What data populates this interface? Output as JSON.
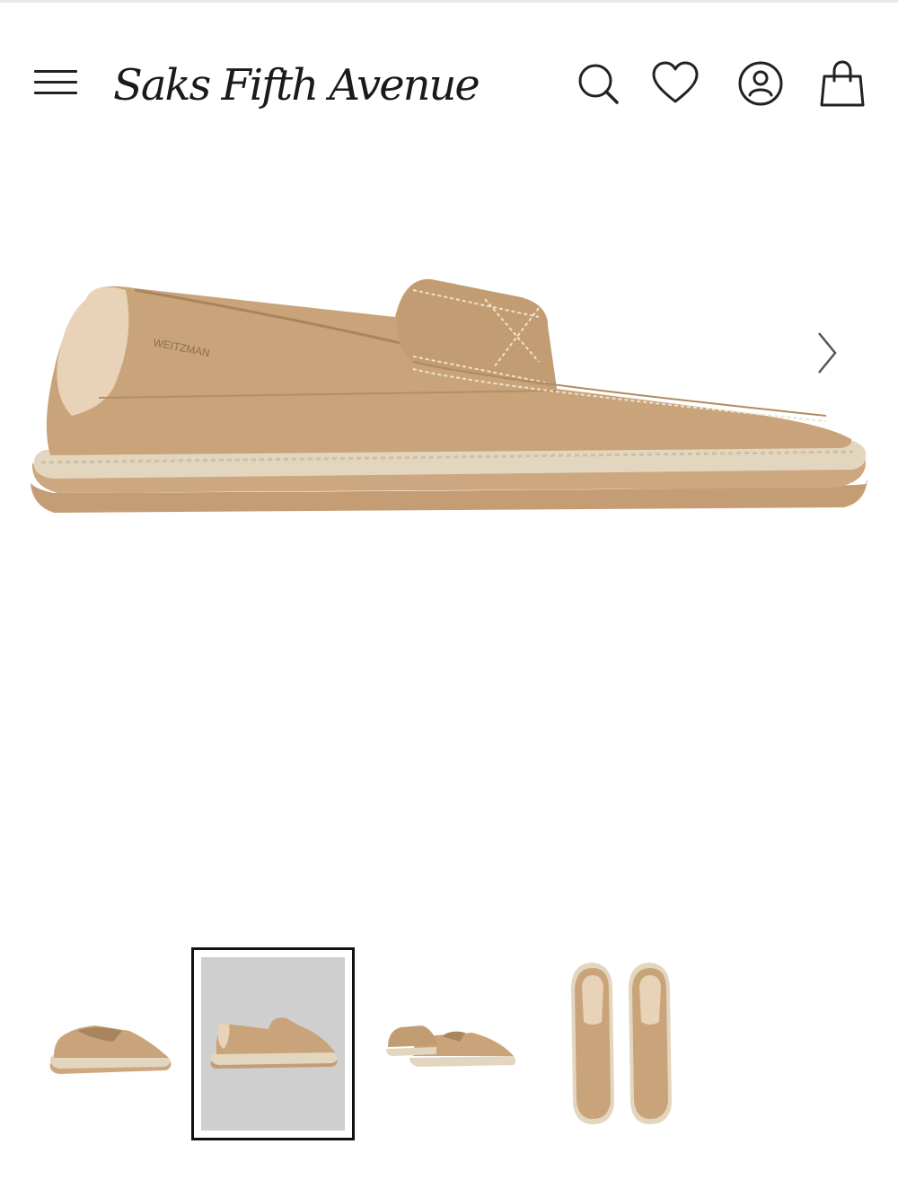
{
  "header": {
    "logo_text": "Saks Fifth Avenue",
    "icons": [
      "menu-icon",
      "search-icon",
      "heart-icon",
      "account-icon",
      "shopping-bag-icon"
    ]
  },
  "product": {
    "brand_mark": "WEITZMAN",
    "colors": {
      "suede": "#c9a47a",
      "rope": "#e3d6bf",
      "sole": "#caa47c",
      "heel_patch": "#e8d2b8"
    }
  },
  "gallery": {
    "thumbnail_count": 4,
    "selected_index": 1
  }
}
